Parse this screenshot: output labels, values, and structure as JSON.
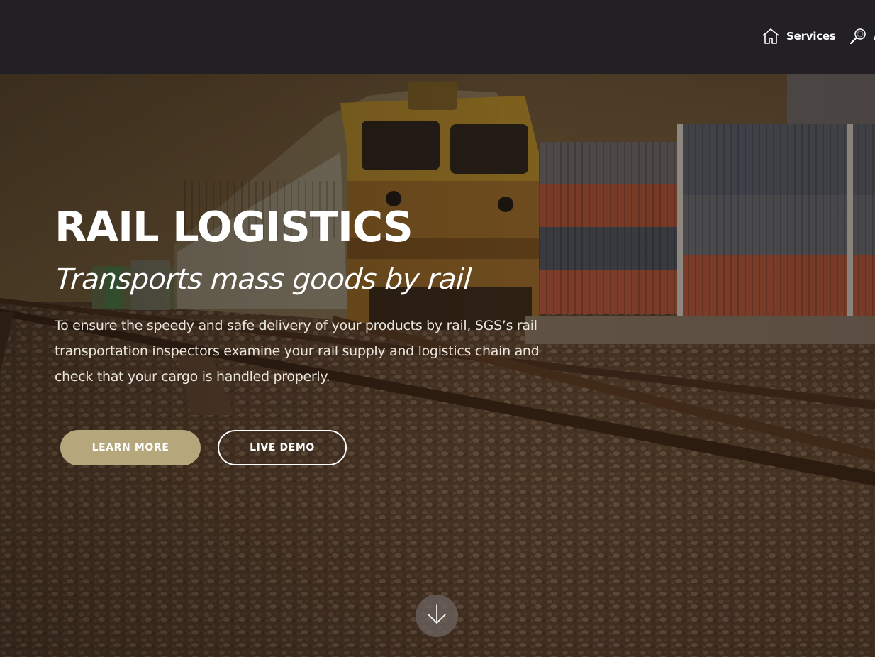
{
  "nav": {
    "items": [
      {
        "label": "Services",
        "icon": "home-icon"
      },
      {
        "label": "A",
        "icon": "search-icon"
      }
    ]
  },
  "hero": {
    "title": "RAIL LOGISTICS",
    "subtitle": "Transports mass goods by rail",
    "description": "To ensure the speedy and safe delivery of your products by rail, SGS’s rail transportation inspectors examine your rail supply and logistics chain and check that your cargo is handled properly.",
    "learn_more_label": "LEARN MORE",
    "live_demo_label": "LIVE DEMO",
    "scroll_icon": "arrow-down-icon"
  },
  "colors": {
    "header_bg": "#222025",
    "primary_button": "#b5a67c",
    "text": "#ffffff"
  }
}
